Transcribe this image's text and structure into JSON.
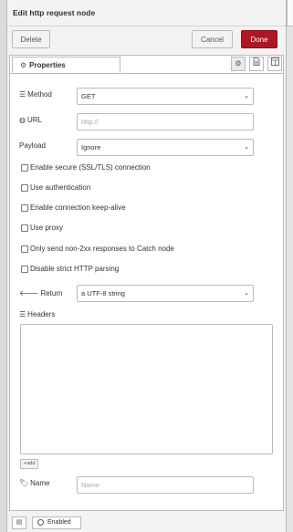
{
  "header": {
    "title": "Edit http request node"
  },
  "toolbar": {
    "delete_label": "Delete",
    "cancel_label": "Cancel",
    "done_label": "Done"
  },
  "tabs": {
    "properties_label": "Properties"
  },
  "form": {
    "method": {
      "label": "Method",
      "value": "GET"
    },
    "url": {
      "label": "URL",
      "placeholder": "http://"
    },
    "payload": {
      "label": "Payload",
      "value": "Ignore"
    },
    "checkboxes": {
      "tls": "Enable secure (SSL/TLS) connection",
      "auth": "Use authentication",
      "keepalive": "Enable connection keep-alive",
      "proxy": "Use proxy",
      "non2xx": "Only send non-2xx responses to Catch node",
      "strict": "Disable strict HTTP parsing"
    },
    "return": {
      "label": "Return",
      "value": "a UTF-8 string"
    },
    "headers": {
      "label": "Headers",
      "add_label": "add"
    },
    "name": {
      "label": "Name",
      "placeholder": "Name"
    }
  },
  "footer": {
    "enabled_label": "Enabled"
  },
  "colors": {
    "done_button": "#ad1625",
    "panel_background": "#ffffff",
    "tray_background": "#f3f3f3"
  },
  "icons": {
    "settings": "gear-icon",
    "description": "file-icon",
    "appearance": "layout-icon",
    "method": "list-icon",
    "url": "globe-icon",
    "return": "arrow-left-icon",
    "headers": "list-icon",
    "name": "tag-icon"
  }
}
